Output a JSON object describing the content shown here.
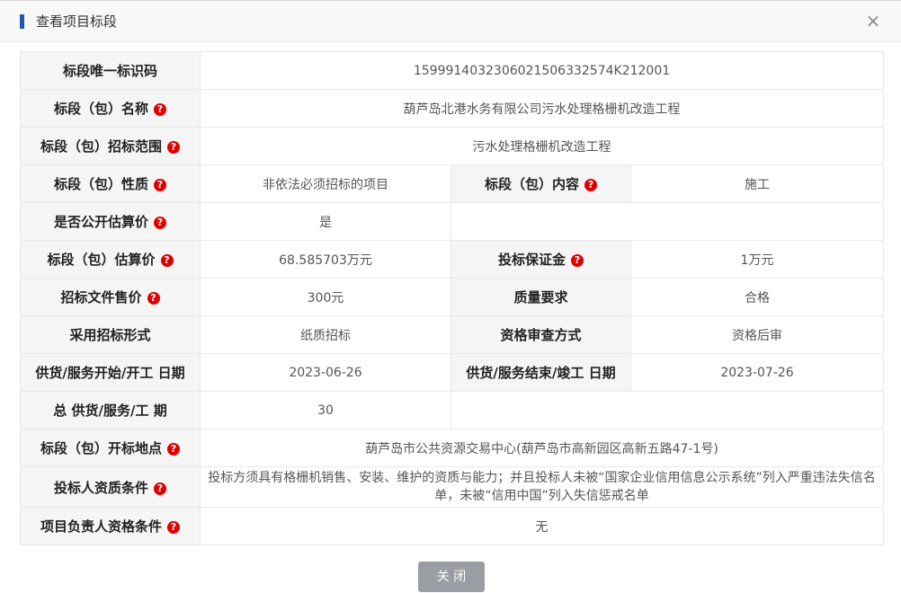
{
  "dialog": {
    "title": "查看项目标段",
    "close_symbol": "×",
    "required_symbol": "?",
    "close_button_label": "关 闭"
  },
  "rows": {
    "r1": {
      "label": "标段唯一标识码",
      "value": "1599914032306021506332574K212001"
    },
    "r2": {
      "label": "标段（包）名称",
      "value": "葫芦岛北港水务有限公司污水处理格栅机改造工程"
    },
    "r3": {
      "label": "标段（包）招标范围",
      "value": "污水处理格栅机改造工程"
    },
    "r4": {
      "label_a": "标段（包）性质",
      "value_a": "非依法必须招标的项目",
      "label_b": "标段（包）内容",
      "value_b": "施工"
    },
    "r5": {
      "label": "是否公开估算价",
      "value": "是"
    },
    "r6": {
      "label_a": "标段（包）估算价",
      "value_a": "68.585703万元",
      "label_b": "投标保证金",
      "value_b": "1万元"
    },
    "r7": {
      "label_a": "招标文件售价",
      "value_a": "300元",
      "label_b": "质量要求",
      "value_b": "合格"
    },
    "r8": {
      "label_a": "采用招标形式",
      "value_a": "纸质招标",
      "label_b": "资格审查方式",
      "value_b": "资格后审"
    },
    "r9": {
      "label_a": "供货/服务开始/开工 日期",
      "value_a": "2023-06-26",
      "label_b": "供货/服务结束/竣工 日期",
      "value_b": "2023-07-26"
    },
    "r10": {
      "label": "总 供货/服务/工 期",
      "value": "30"
    },
    "r11": {
      "label": "标段（包）开标地点",
      "value": "葫芦岛市公共资源交易中心(葫芦岛市高新园区高新五路47-1号)"
    },
    "r12": {
      "label": "投标人资质条件",
      "value": "投标方须具有格栅机销售、安装、维护的资质与能力；并且投标人未被“国家企业信用信息公示系统”列入严重违法失信名单，未被“信用中国”列入失信惩戒名单"
    },
    "r13": {
      "label": "项目负责人资格条件",
      "value": "无"
    }
  }
}
